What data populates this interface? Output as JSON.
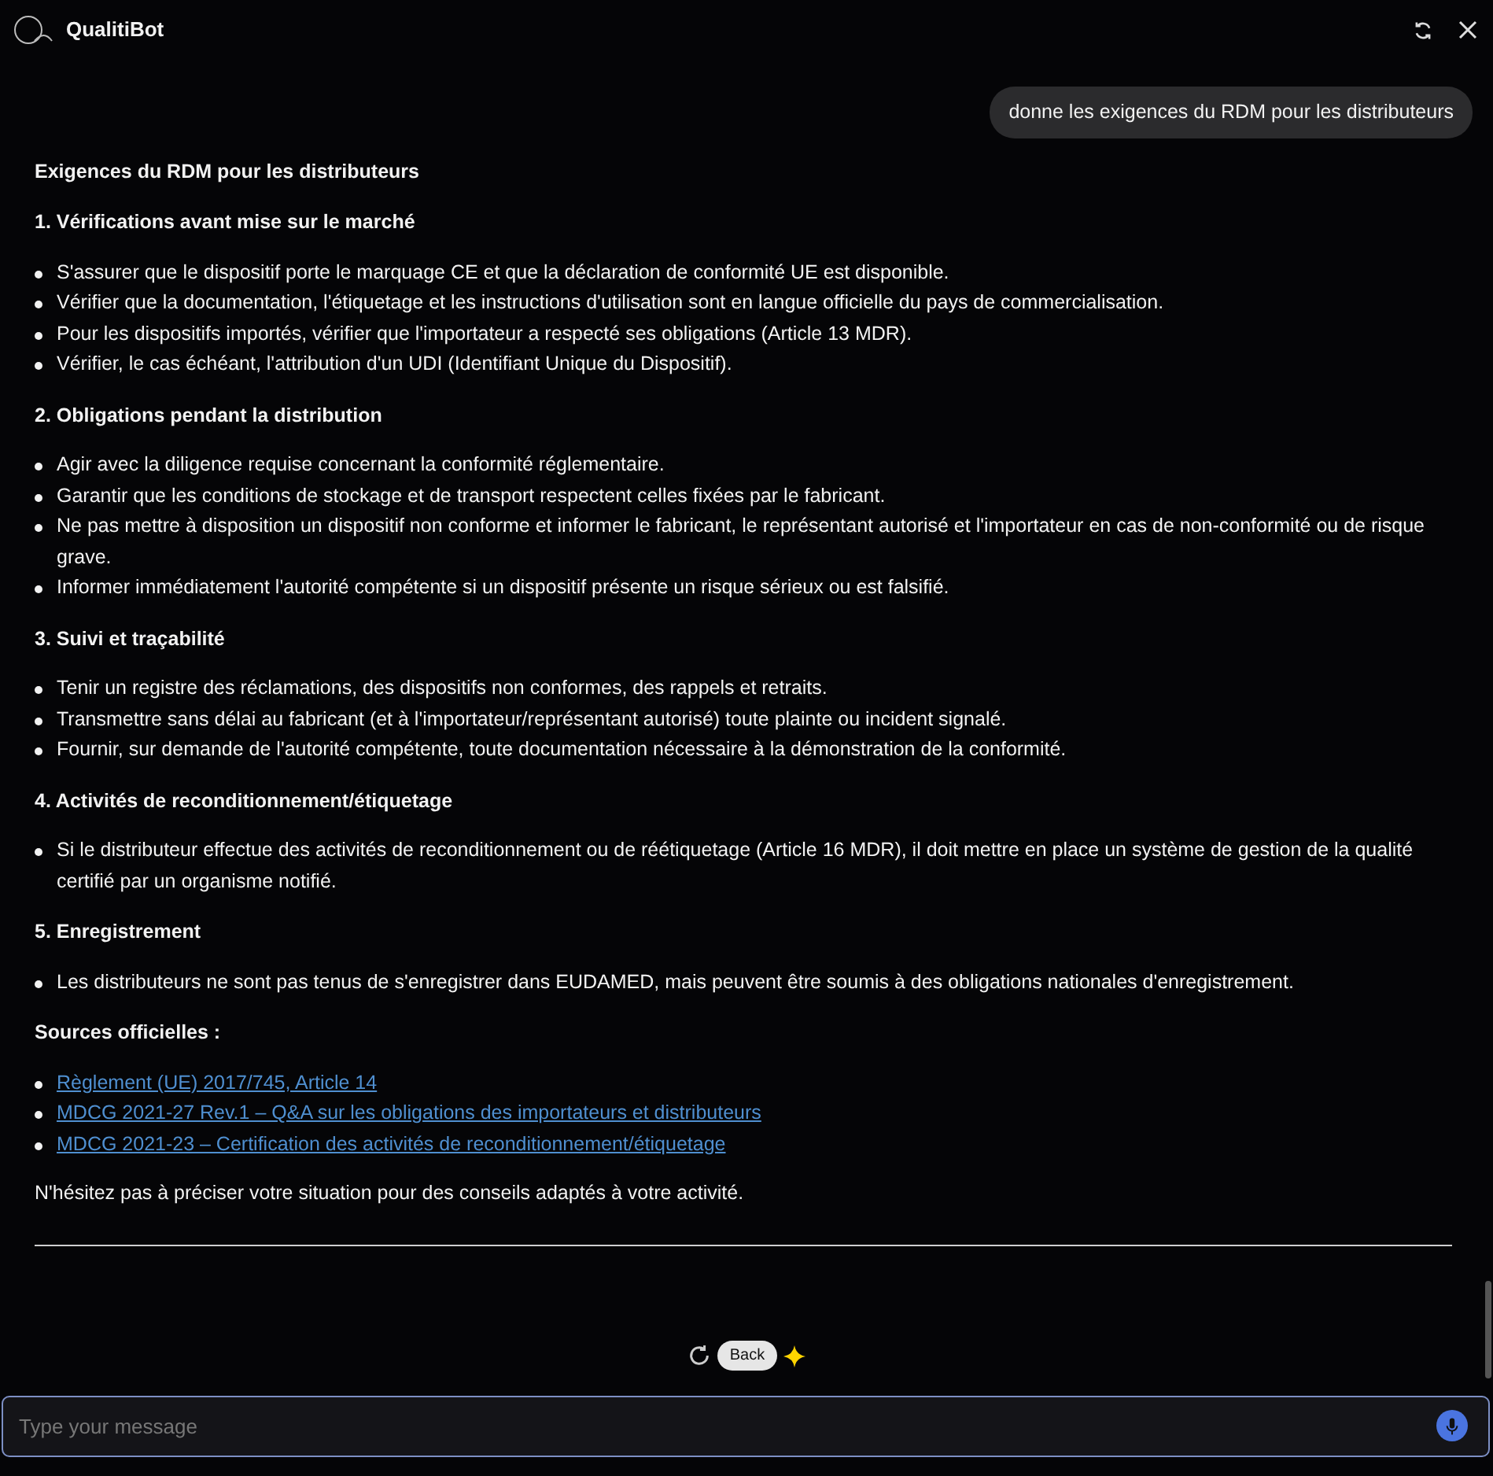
{
  "app": {
    "title": "QualitiBot"
  },
  "user_message": "donne les exigences du RDM pour les distributeurs",
  "answer": {
    "title": "Exigences du RDM pour les distributeurs",
    "sections": [
      {
        "heading": "1. Vérifications avant mise sur le marché",
        "items": [
          "S'assurer que le dispositif porte le marquage CE et que la déclaration de conformité UE est disponible.",
          "Vérifier que la documentation, l'étiquetage et les instructions d'utilisation sont en langue officielle du pays de commercialisation.",
          "Pour les dispositifs importés, vérifier que l'importateur a respecté ses obligations (Article 13 MDR).",
          "Vérifier, le cas échéant, l'attribution d'un UDI (Identifiant Unique du Dispositif)."
        ]
      },
      {
        "heading": "2. Obligations pendant la distribution",
        "items": [
          "Agir avec la diligence requise concernant la conformité réglementaire.",
          "Garantir que les conditions de stockage et de transport respectent celles fixées par le fabricant.",
          "Ne pas mettre à disposition un dispositif non conforme et informer le fabricant, le représentant autorisé et l'importateur en cas de non-conformité ou de risque grave.",
          "Informer immédiatement l'autorité compétente si un dispositif présente un risque sérieux ou est falsifié."
        ]
      },
      {
        "heading": "3. Suivi et traçabilité",
        "items": [
          "Tenir un registre des réclamations, des dispositifs non conformes, des rappels et retraits.",
          "Transmettre sans délai au fabricant (et à l'importateur/représentant autorisé) toute plainte ou incident signalé.",
          "Fournir, sur demande de l'autorité compétente, toute documentation nécessaire à la démonstration de la conformité."
        ]
      },
      {
        "heading": "4. Activités de reconditionnement/étiquetage",
        "items": [
          "Si le distributeur effectue des activités de reconditionnement ou de réétiquetage (Article 16 MDR), il doit mettre en place un système de gestion de la qualité certifié par un organisme notifié."
        ]
      },
      {
        "heading": "5. Enregistrement",
        "items": [
          "Les distributeurs ne sont pas tenus de s'enregistrer dans EUDAMED, mais peuvent être soumis à des obligations nationales d'enregistrement."
        ]
      }
    ],
    "sources_heading": "Sources officielles :",
    "sources": [
      "Règlement (UE) 2017/745, Article 14",
      "MDCG 2021-27 Rev.1 – Q&A sur les obligations des importateurs et distributeurs",
      "MDCG 2021-23 – Certification des activités de reconditionnement/étiquetage"
    ],
    "closing": "N'hésitez pas à préciser votre situation pour des conseils adaptés à votre activité."
  },
  "back_button": "Back",
  "composer": {
    "placeholder": "Type your message"
  }
}
